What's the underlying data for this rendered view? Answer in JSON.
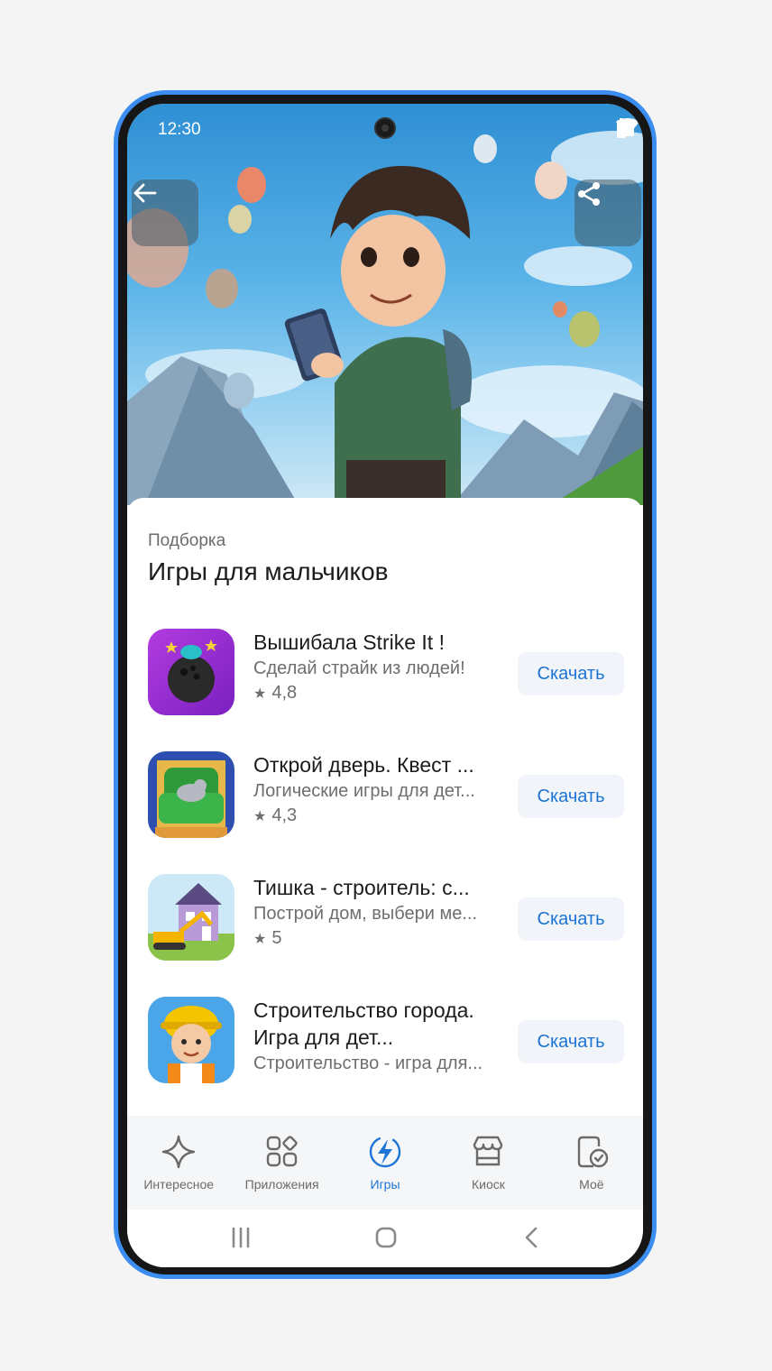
{
  "status_bar": {
    "time": "12:30"
  },
  "collection": {
    "kicker": "Подборка",
    "title": "Игры для мальчиков"
  },
  "apps": [
    {
      "name": "Вышибала Strike It !",
      "description": "Сделай страйк из людей!",
      "rating": "4,8",
      "action": "Скачать",
      "icon": "bowling-ball-icon"
    },
    {
      "name": "Открой дверь. Квест ...",
      "description": "Логические игры для дет...",
      "rating": "4,3",
      "action": "Скачать",
      "icon": "cat-armchair-icon"
    },
    {
      "name": "Тишка - строитель: с...",
      "description": "Построй дом, выбери ме...",
      "rating": "5",
      "action": "Скачать",
      "icon": "house-excavator-icon"
    },
    {
      "name": "Строительство города. Игра для дет...",
      "description": "Строительство - игра для...",
      "rating": "",
      "action": "Скачать",
      "icon": "builder-boy-icon"
    }
  ],
  "tabs": [
    {
      "label": "Интересное",
      "icon": "sparkle-icon",
      "active": false
    },
    {
      "label": "Приложения",
      "icon": "apps-grid-icon",
      "active": false
    },
    {
      "label": "Игры",
      "icon": "lightning-icon",
      "active": true
    },
    {
      "label": "Киоск",
      "icon": "kiosk-icon",
      "active": false
    },
    {
      "label": "Моё",
      "icon": "my-apps-icon",
      "active": false
    }
  ],
  "colors": {
    "accent": "#1d74d6",
    "phone_frame": "#3b8ef0",
    "button_bg": "#f1f4f8"
  }
}
